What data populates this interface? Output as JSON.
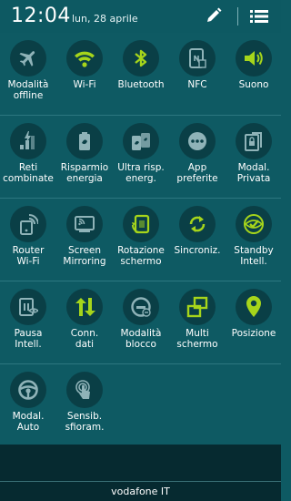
{
  "status": {
    "time": "12:04",
    "date": "lun, 28 aprile"
  },
  "colors": {
    "active": "#a6d51b",
    "inactive": "#8fb3b8",
    "background": "#0e5a63",
    "circle": "#0a3f46"
  },
  "rows": [
    [
      {
        "label": "Modalità\noffline",
        "icon": "airplane-icon",
        "active": false
      },
      {
        "label": "Wi-Fi",
        "icon": "wifi-icon",
        "active": true
      },
      {
        "label": "Bluetooth",
        "icon": "bluetooth-icon",
        "active": true
      },
      {
        "label": "NFC",
        "icon": "nfc-icon",
        "active": false
      },
      {
        "label": "Suono",
        "icon": "sound-icon",
        "active": true
      }
    ],
    [
      {
        "label": "Reti\ncombinate",
        "icon": "combined-networks-icon",
        "active": false
      },
      {
        "label": "Risparmio\nenergia",
        "icon": "power-saving-icon",
        "active": false
      },
      {
        "label": "Ultra risp.\nenerg.",
        "icon": "ultra-power-saving-icon",
        "active": false
      },
      {
        "label": "App\npreferite",
        "icon": "favorite-apps-icon",
        "active": false
      },
      {
        "label": "Modal.\nPrivata",
        "icon": "private-mode-icon",
        "active": false
      }
    ],
    [
      {
        "label": "Router\nWi-Fi",
        "icon": "wifi-router-icon",
        "active": false
      },
      {
        "label": "Screen\nMirroring",
        "icon": "screen-mirroring-icon",
        "active": false
      },
      {
        "label": "Rotazione\nschermo",
        "icon": "screen-rotation-icon",
        "active": true
      },
      {
        "label": "Sincroniz.",
        "icon": "sync-icon",
        "active": true
      },
      {
        "label": "Standby\nIntell.",
        "icon": "smart-stay-icon",
        "active": true
      }
    ],
    [
      {
        "label": "Pausa\nIntell.",
        "icon": "smart-pause-icon",
        "active": false
      },
      {
        "label": "Conn.\ndati",
        "icon": "mobile-data-icon",
        "active": true
      },
      {
        "label": "Modalità\nblocco",
        "icon": "blocking-mode-icon",
        "active": false
      },
      {
        "label": "Multi\nschermo",
        "icon": "multi-window-icon",
        "active": true
      },
      {
        "label": "Posizione",
        "icon": "location-icon",
        "active": true
      }
    ],
    [
      {
        "label": "Modal.\nAuto",
        "icon": "car-mode-icon",
        "active": false
      },
      {
        "label": "Sensib.\nsfioram.",
        "icon": "touch-sensitivity-icon",
        "active": false
      }
    ]
  ],
  "carrier": "vodafone IT"
}
